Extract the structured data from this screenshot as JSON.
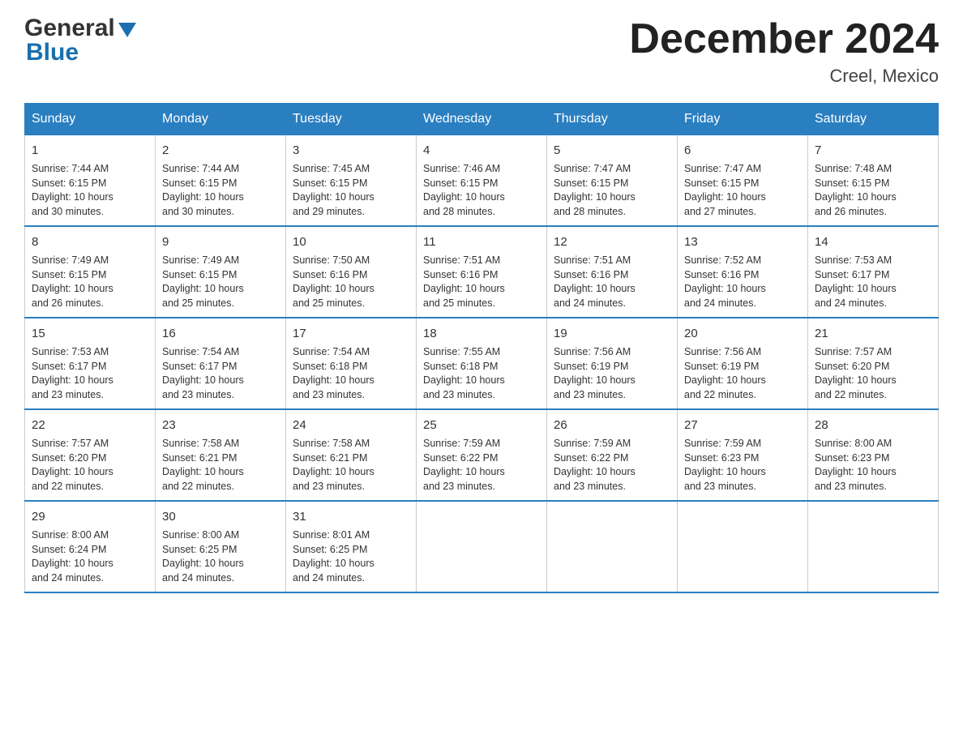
{
  "logo": {
    "general": "General",
    "blue": "Blue"
  },
  "title": "December 2024",
  "location": "Creel, Mexico",
  "days_of_week": [
    "Sunday",
    "Monday",
    "Tuesday",
    "Wednesday",
    "Thursday",
    "Friday",
    "Saturday"
  ],
  "weeks": [
    [
      {
        "day": "1",
        "info": "Sunrise: 7:44 AM\nSunset: 6:15 PM\nDaylight: 10 hours\nand 30 minutes."
      },
      {
        "day": "2",
        "info": "Sunrise: 7:44 AM\nSunset: 6:15 PM\nDaylight: 10 hours\nand 30 minutes."
      },
      {
        "day": "3",
        "info": "Sunrise: 7:45 AM\nSunset: 6:15 PM\nDaylight: 10 hours\nand 29 minutes."
      },
      {
        "day": "4",
        "info": "Sunrise: 7:46 AM\nSunset: 6:15 PM\nDaylight: 10 hours\nand 28 minutes."
      },
      {
        "day": "5",
        "info": "Sunrise: 7:47 AM\nSunset: 6:15 PM\nDaylight: 10 hours\nand 28 minutes."
      },
      {
        "day": "6",
        "info": "Sunrise: 7:47 AM\nSunset: 6:15 PM\nDaylight: 10 hours\nand 27 minutes."
      },
      {
        "day": "7",
        "info": "Sunrise: 7:48 AM\nSunset: 6:15 PM\nDaylight: 10 hours\nand 26 minutes."
      }
    ],
    [
      {
        "day": "8",
        "info": "Sunrise: 7:49 AM\nSunset: 6:15 PM\nDaylight: 10 hours\nand 26 minutes."
      },
      {
        "day": "9",
        "info": "Sunrise: 7:49 AM\nSunset: 6:15 PM\nDaylight: 10 hours\nand 25 minutes."
      },
      {
        "day": "10",
        "info": "Sunrise: 7:50 AM\nSunset: 6:16 PM\nDaylight: 10 hours\nand 25 minutes."
      },
      {
        "day": "11",
        "info": "Sunrise: 7:51 AM\nSunset: 6:16 PM\nDaylight: 10 hours\nand 25 minutes."
      },
      {
        "day": "12",
        "info": "Sunrise: 7:51 AM\nSunset: 6:16 PM\nDaylight: 10 hours\nand 24 minutes."
      },
      {
        "day": "13",
        "info": "Sunrise: 7:52 AM\nSunset: 6:16 PM\nDaylight: 10 hours\nand 24 minutes."
      },
      {
        "day": "14",
        "info": "Sunrise: 7:53 AM\nSunset: 6:17 PM\nDaylight: 10 hours\nand 24 minutes."
      }
    ],
    [
      {
        "day": "15",
        "info": "Sunrise: 7:53 AM\nSunset: 6:17 PM\nDaylight: 10 hours\nand 23 minutes."
      },
      {
        "day": "16",
        "info": "Sunrise: 7:54 AM\nSunset: 6:17 PM\nDaylight: 10 hours\nand 23 minutes."
      },
      {
        "day": "17",
        "info": "Sunrise: 7:54 AM\nSunset: 6:18 PM\nDaylight: 10 hours\nand 23 minutes."
      },
      {
        "day": "18",
        "info": "Sunrise: 7:55 AM\nSunset: 6:18 PM\nDaylight: 10 hours\nand 23 minutes."
      },
      {
        "day": "19",
        "info": "Sunrise: 7:56 AM\nSunset: 6:19 PM\nDaylight: 10 hours\nand 23 minutes."
      },
      {
        "day": "20",
        "info": "Sunrise: 7:56 AM\nSunset: 6:19 PM\nDaylight: 10 hours\nand 22 minutes."
      },
      {
        "day": "21",
        "info": "Sunrise: 7:57 AM\nSunset: 6:20 PM\nDaylight: 10 hours\nand 22 minutes."
      }
    ],
    [
      {
        "day": "22",
        "info": "Sunrise: 7:57 AM\nSunset: 6:20 PM\nDaylight: 10 hours\nand 22 minutes."
      },
      {
        "day": "23",
        "info": "Sunrise: 7:58 AM\nSunset: 6:21 PM\nDaylight: 10 hours\nand 22 minutes."
      },
      {
        "day": "24",
        "info": "Sunrise: 7:58 AM\nSunset: 6:21 PM\nDaylight: 10 hours\nand 23 minutes."
      },
      {
        "day": "25",
        "info": "Sunrise: 7:59 AM\nSunset: 6:22 PM\nDaylight: 10 hours\nand 23 minutes."
      },
      {
        "day": "26",
        "info": "Sunrise: 7:59 AM\nSunset: 6:22 PM\nDaylight: 10 hours\nand 23 minutes."
      },
      {
        "day": "27",
        "info": "Sunrise: 7:59 AM\nSunset: 6:23 PM\nDaylight: 10 hours\nand 23 minutes."
      },
      {
        "day": "28",
        "info": "Sunrise: 8:00 AM\nSunset: 6:23 PM\nDaylight: 10 hours\nand 23 minutes."
      }
    ],
    [
      {
        "day": "29",
        "info": "Sunrise: 8:00 AM\nSunset: 6:24 PM\nDaylight: 10 hours\nand 24 minutes."
      },
      {
        "day": "30",
        "info": "Sunrise: 8:00 AM\nSunset: 6:25 PM\nDaylight: 10 hours\nand 24 minutes."
      },
      {
        "day": "31",
        "info": "Sunrise: 8:01 AM\nSunset: 6:25 PM\nDaylight: 10 hours\nand 24 minutes."
      },
      null,
      null,
      null,
      null
    ]
  ]
}
